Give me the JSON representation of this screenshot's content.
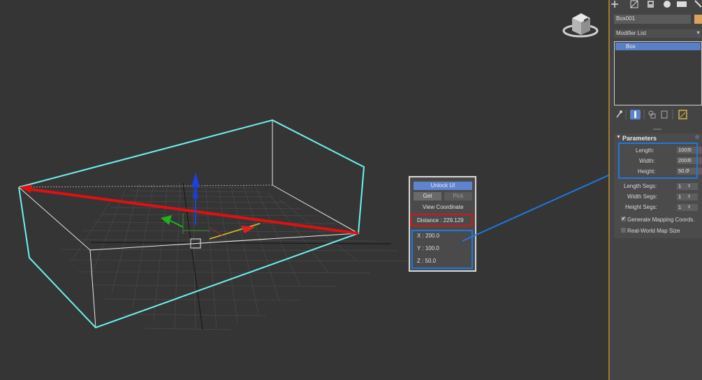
{
  "panel": {
    "object_name": "Box001",
    "object_color": "#dca35f",
    "modifier_list_label": "Modifier List",
    "stack_items": [
      "Box"
    ],
    "rollout_title": "Parameters",
    "params": [
      {
        "label": "Length:",
        "value": "100.0"
      },
      {
        "label": "Width:",
        "value": "200.0"
      },
      {
        "label": "Height:",
        "value": "50.0"
      },
      {
        "label": "Length Segs:",
        "value": "1"
      },
      {
        "label": "Width Segs:",
        "value": "1"
      },
      {
        "label": "Height Segs:",
        "value": "1"
      }
    ],
    "checkboxes": [
      {
        "label": "Generate Mapping Coords.",
        "checked": true
      },
      {
        "label": "Real-World Map Size",
        "checked": false
      }
    ],
    "toolbar_icons": [
      "create-icon",
      "modify-icon",
      "hierarchy-icon",
      "motion-icon",
      "display-icon",
      "utilities-icon"
    ]
  },
  "tool": {
    "unlock_label": "Unlock UI",
    "get_label": "Get",
    "pick_label": "Pick",
    "view_coord_label": "View Coordinate",
    "distance_text": "Distance : 229.129",
    "x_text": "X : 200.0",
    "y_text": "Y : 100.0",
    "z_text": "Z : 50.0"
  },
  "colors": {
    "selection_cyan": "#6ff0f0",
    "distance_line": "#e01010",
    "highlight_red": "#d01818",
    "highlight_blue": "#1e78e0",
    "panel_bg": "#444444",
    "viewport_bg": "#353535"
  }
}
